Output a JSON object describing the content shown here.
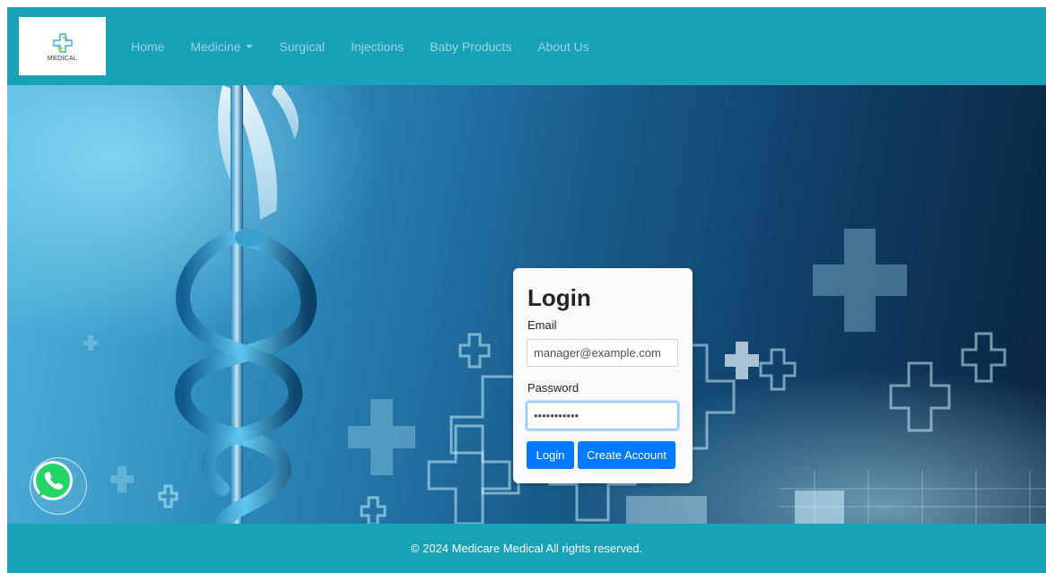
{
  "brand": {
    "name": "MEDICAL",
    "logo_icon": "medical-cross-icon"
  },
  "nav": {
    "items": [
      {
        "label": "Home"
      },
      {
        "label": "Medicine"
      },
      {
        "label": "Surgical"
      },
      {
        "label": "Injections"
      },
      {
        "label": "Baby Products"
      },
      {
        "label": "About Us"
      }
    ]
  },
  "login": {
    "title": "Login",
    "email_label": "Email",
    "email_value": "manager@example.com",
    "password_label": "Password",
    "password_value": "•••••••••••",
    "login_button": "Login",
    "create_account_button": "Create Account"
  },
  "footer": {
    "text": "© 2024 Medicare Medical All rights reserved."
  },
  "colors": {
    "navbar": "#17a2b8",
    "primary_button": "#007bff",
    "whatsapp": "#25d366"
  },
  "icons": {
    "whatsapp": "whatsapp-icon",
    "dropdown": "chevron-down-icon"
  }
}
